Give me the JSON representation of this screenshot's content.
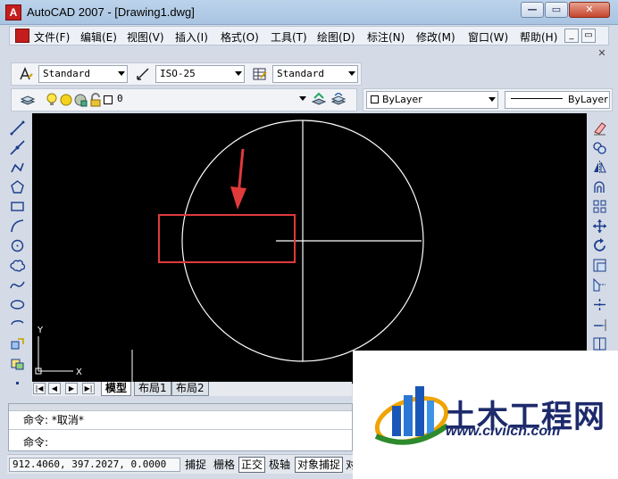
{
  "window": {
    "title": "AutoCAD 2007 - [Drawing1.dwg]",
    "app_icon_glyph": "A",
    "minimize_glyph": "—",
    "restore_glyph": "▭",
    "close_glyph": "✕"
  },
  "menubar": {
    "items": [
      "文件(F)",
      "编辑(E)",
      "视图(V)",
      "插入(I)",
      "格式(O)",
      "工具(T)",
      "绘图(D)",
      "标注(N)",
      "修改(M)",
      "窗口(W)",
      "帮助(H)"
    ],
    "mdi_minimize_glyph": "_",
    "mdi_restore_glyph": "▭",
    "mdi_close_glyph": "✕"
  },
  "styles_toolbar": {
    "text_style": "Standard",
    "dim_style": "ISO-25",
    "table_style": "Standard"
  },
  "layers_toolbar": {
    "current_layer": "0"
  },
  "properties_toolbar": {
    "color": "ByLayer",
    "linetype": "ByLayer"
  },
  "canvas": {
    "background": "#000000",
    "entity_color": "#ffffff",
    "highlight_color": "#e03a3a",
    "ucs_x_label": "X",
    "ucs_y_label": "Y"
  },
  "layout_tabs": {
    "nav_glyphs": [
      "|◀",
      "◀",
      "▶",
      "▶|"
    ],
    "tabs": [
      "模型",
      "布局1",
      "布局2"
    ],
    "active": "模型"
  },
  "command_window": {
    "line1": "命令: *取消*",
    "line2": "命令:"
  },
  "statusbar": {
    "coordinates": "912.4060,  397.2027, 0.0000",
    "buttons": [
      {
        "label": "捕捉",
        "on": false
      },
      {
        "label": "栅格",
        "on": false
      },
      {
        "label": "正交",
        "on": true
      },
      {
        "label": "极轴",
        "on": false
      },
      {
        "label": "对象捕捉",
        "on": true
      },
      {
        "label": "对",
        "on": false
      }
    ]
  },
  "watermark": {
    "title": "土木工程网",
    "url": "www.civilcn.com"
  },
  "icons": {
    "left_toolbar": [
      "line-icon",
      "construction-line-icon",
      "polyline-icon",
      "polygon-icon",
      "rectangle-icon",
      "arc-icon",
      "circle-icon",
      "revision-cloud-icon",
      "spline-icon",
      "ellipse-icon",
      "ellipse-arc-icon",
      "insert-block-icon",
      "make-block-icon",
      "point-icon"
    ],
    "right_toolbar": [
      "erase-icon",
      "copy-icon",
      "mirror-icon",
      "offset-icon",
      "array-icon",
      "move-icon",
      "rotate-icon",
      "scale-icon",
      "stretch-icon",
      "trim-icon",
      "extend-icon",
      "break-icon"
    ]
  }
}
